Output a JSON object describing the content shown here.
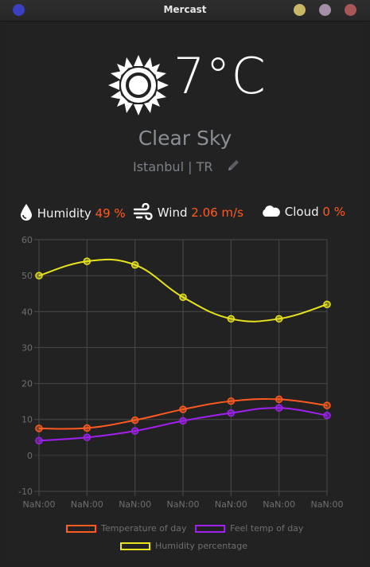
{
  "window": {
    "title": "Mercast",
    "controls": {
      "left_dot_color": "#3a40c0",
      "minimize_color": "#c8b866",
      "maximize_color": "#a58fa8",
      "close_color": "#a85656"
    }
  },
  "weather": {
    "icon": "sun-icon",
    "temperature": "7°C",
    "condition": "Clear Sky",
    "location": "Istanbul | TR",
    "edit_icon": "pencil-icon"
  },
  "stats": {
    "humidity_label": "Humidity",
    "humidity_value": "49 %",
    "wind_label": "Wind",
    "wind_value": "2.06 m/s",
    "cloud_label": "Cloud",
    "cloud_value": "0 %"
  },
  "colors": {
    "accent": "#ff5a1f",
    "temperature_series": "#ff5a1f",
    "feel_series": "#a020f0",
    "humidity_series": "#e8e31a"
  },
  "chart_data": {
    "type": "line",
    "x": [
      "NaN:00",
      "NaN:00",
      "NaN:00",
      "NaN:00",
      "NaN:00",
      "NaN:00",
      "NaN:00"
    ],
    "ylim": [
      -10,
      60
    ],
    "yticks": [
      "60",
      "50",
      "40",
      "30",
      "20",
      "10",
      "0",
      "-10"
    ],
    "grid": true,
    "legend_placement": "bottom",
    "series": [
      {
        "name": "Temperature of day",
        "color": "#ff5a1f",
        "values": [
          7.5,
          7.6,
          9.8,
          12.8,
          15.1,
          15.6,
          13.9
        ]
      },
      {
        "name": "Feel temp of day",
        "color": "#a020f0",
        "values": [
          4.1,
          5.0,
          6.8,
          9.6,
          11.8,
          13.2,
          11.1
        ]
      },
      {
        "name": "Humidity percentage",
        "color": "#e8e31a",
        "values": [
          50,
          54,
          53,
          44,
          38,
          38,
          42
        ]
      }
    ]
  }
}
